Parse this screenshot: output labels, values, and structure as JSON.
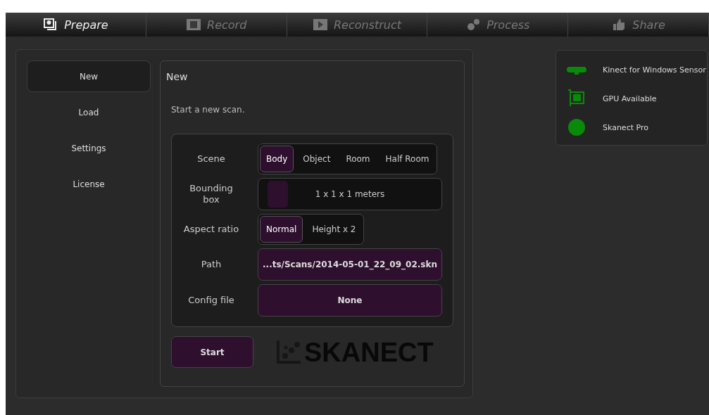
{
  "steps": [
    {
      "label": "Prepare",
      "selected": true
    },
    {
      "label": "Record",
      "selected": false
    },
    {
      "label": "Reconstruct",
      "selected": false
    },
    {
      "label": "Process",
      "selected": false
    },
    {
      "label": "Share",
      "selected": false
    }
  ],
  "sidebar": {
    "items": [
      {
        "label": "New",
        "selected": true
      },
      {
        "label": "Load",
        "selected": false
      },
      {
        "label": "Settings",
        "selected": false
      },
      {
        "label": "License",
        "selected": false
      }
    ]
  },
  "panel": {
    "title": "New",
    "description": "Start a new scan.",
    "fields": [
      {
        "kind": "segmented",
        "label": "Scene",
        "options": [
          {
            "label": "Body",
            "selected": true
          },
          {
            "label": "Object",
            "selected": false
          },
          {
            "label": "Room",
            "selected": false
          },
          {
            "label": "Half Room",
            "selected": false
          }
        ]
      },
      {
        "kind": "slider",
        "label": "Bounding box",
        "value": "1 x 1 x 1 meters",
        "level": 0.05
      },
      {
        "kind": "segmented",
        "label": "Aspect ratio",
        "options": [
          {
            "label": "Normal",
            "selected": true
          },
          {
            "label": "Height x 2",
            "selected": false
          }
        ]
      },
      {
        "kind": "button",
        "label": "Path",
        "value": "...ts/Scans/2014-05-01_22_09_02.skn"
      },
      {
        "kind": "button",
        "label": "Config file",
        "value": "None"
      }
    ],
    "start_button": "Start",
    "logo": "SKANECT"
  },
  "status": [
    {
      "label": "Kinect for Windows Sensor",
      "color": "#0a8a0a"
    },
    {
      "label": "GPU Available",
      "color": "#0a8a0a"
    },
    {
      "label": "Skanect Pro",
      "color": "#0a8a0a"
    }
  ]
}
